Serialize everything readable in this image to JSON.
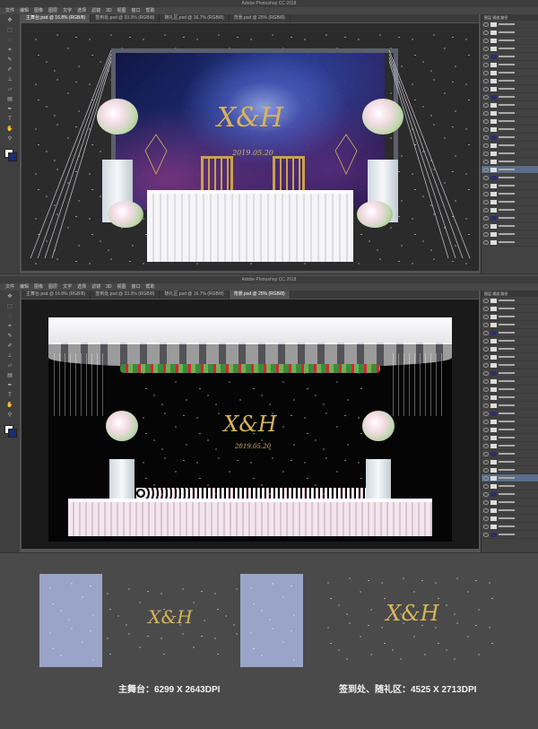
{
  "window1": {
    "title": "Adobe Photoshop CC 2018",
    "menu": [
      "文件",
      "编辑",
      "图像",
      "图层",
      "文字",
      "选择",
      "滤镜",
      "3D",
      "视图",
      "窗口",
      "帮助"
    ],
    "tabs": [
      "主舞台.psd @ 16.8% (RGB/8)",
      "签到处.psd @ 33.3% (RGB/8)",
      "随礼区.psd @ 16.7% (RGB/8)",
      "背景.psd @ 25% (RGB/8)"
    ],
    "active_tab_index": 0,
    "monogram": "X&H",
    "subtitle": "2019.05.20"
  },
  "window2": {
    "title": "Adobe Photoshop CC 2018",
    "menu": [
      "文件",
      "编辑",
      "图像",
      "图层",
      "文字",
      "选择",
      "滤镜",
      "3D",
      "视图",
      "窗口",
      "帮助"
    ],
    "tabs": [
      "主舞台.psd @ 16.8% (RGB/8)",
      "签到处.psd @ 33.3% (RGB/8)",
      "随礼区.psd @ 16.7% (RGB/8)",
      "背景.psd @ 25% (RGB/8)"
    ],
    "active_tab_index": 3,
    "monogram": "X&H",
    "subtitle": "2019.05.20"
  },
  "preview": {
    "monogram": "X&H",
    "caption_left": "主舞台：6299 X 2643DPI",
    "caption_right": "签到处、随礼区：4525 X 2713DPI"
  },
  "colors": {
    "app_bg": "#4a4a4a",
    "panel": "#535353",
    "gold": "#d7b35a",
    "galaxy_dark": "#0e1648"
  }
}
